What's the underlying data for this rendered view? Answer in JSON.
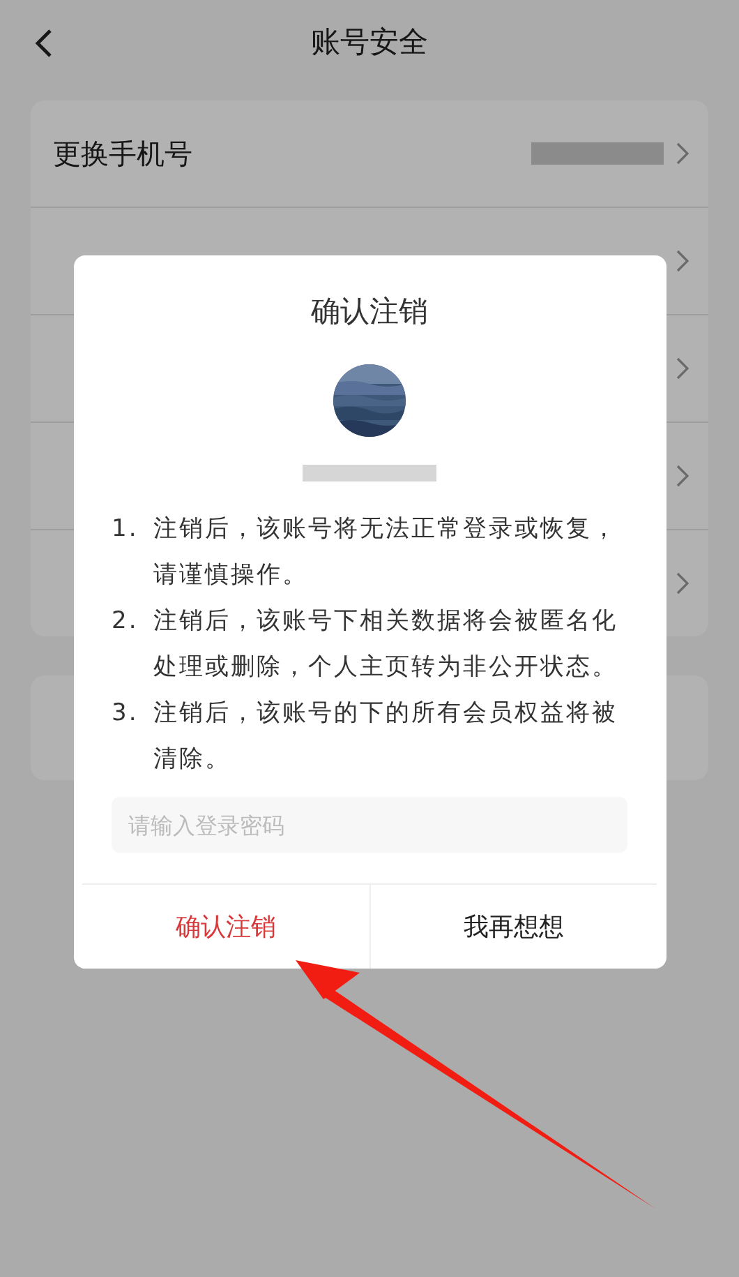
{
  "header": {
    "title": "账号安全"
  },
  "settings": {
    "first_row": {
      "label": "更换手机号",
      "redacted_value": true
    }
  },
  "dialog": {
    "title": "确认注销",
    "name_redacted": true,
    "terms": [
      {
        "number": "1.",
        "text": "注销后，该账号将无法正常登录或恢复，请谨慎操作。"
      },
      {
        "number": "2.",
        "text": "注销后，该账号下相关数据将会被匿名化处理或删除，个人主页转为非公开状态。"
      },
      {
        "number": "3.",
        "text": "注销后，该账号的下的所有会员权益将被清除。"
      }
    ],
    "password": {
      "placeholder": "请输入登录密码"
    },
    "buttons": [
      {
        "label": "确认注销",
        "kind": "confirm"
      },
      {
        "label": "我再想想",
        "kind": "cancel"
      }
    ]
  },
  "annotation": {
    "kind": "arrow"
  }
}
